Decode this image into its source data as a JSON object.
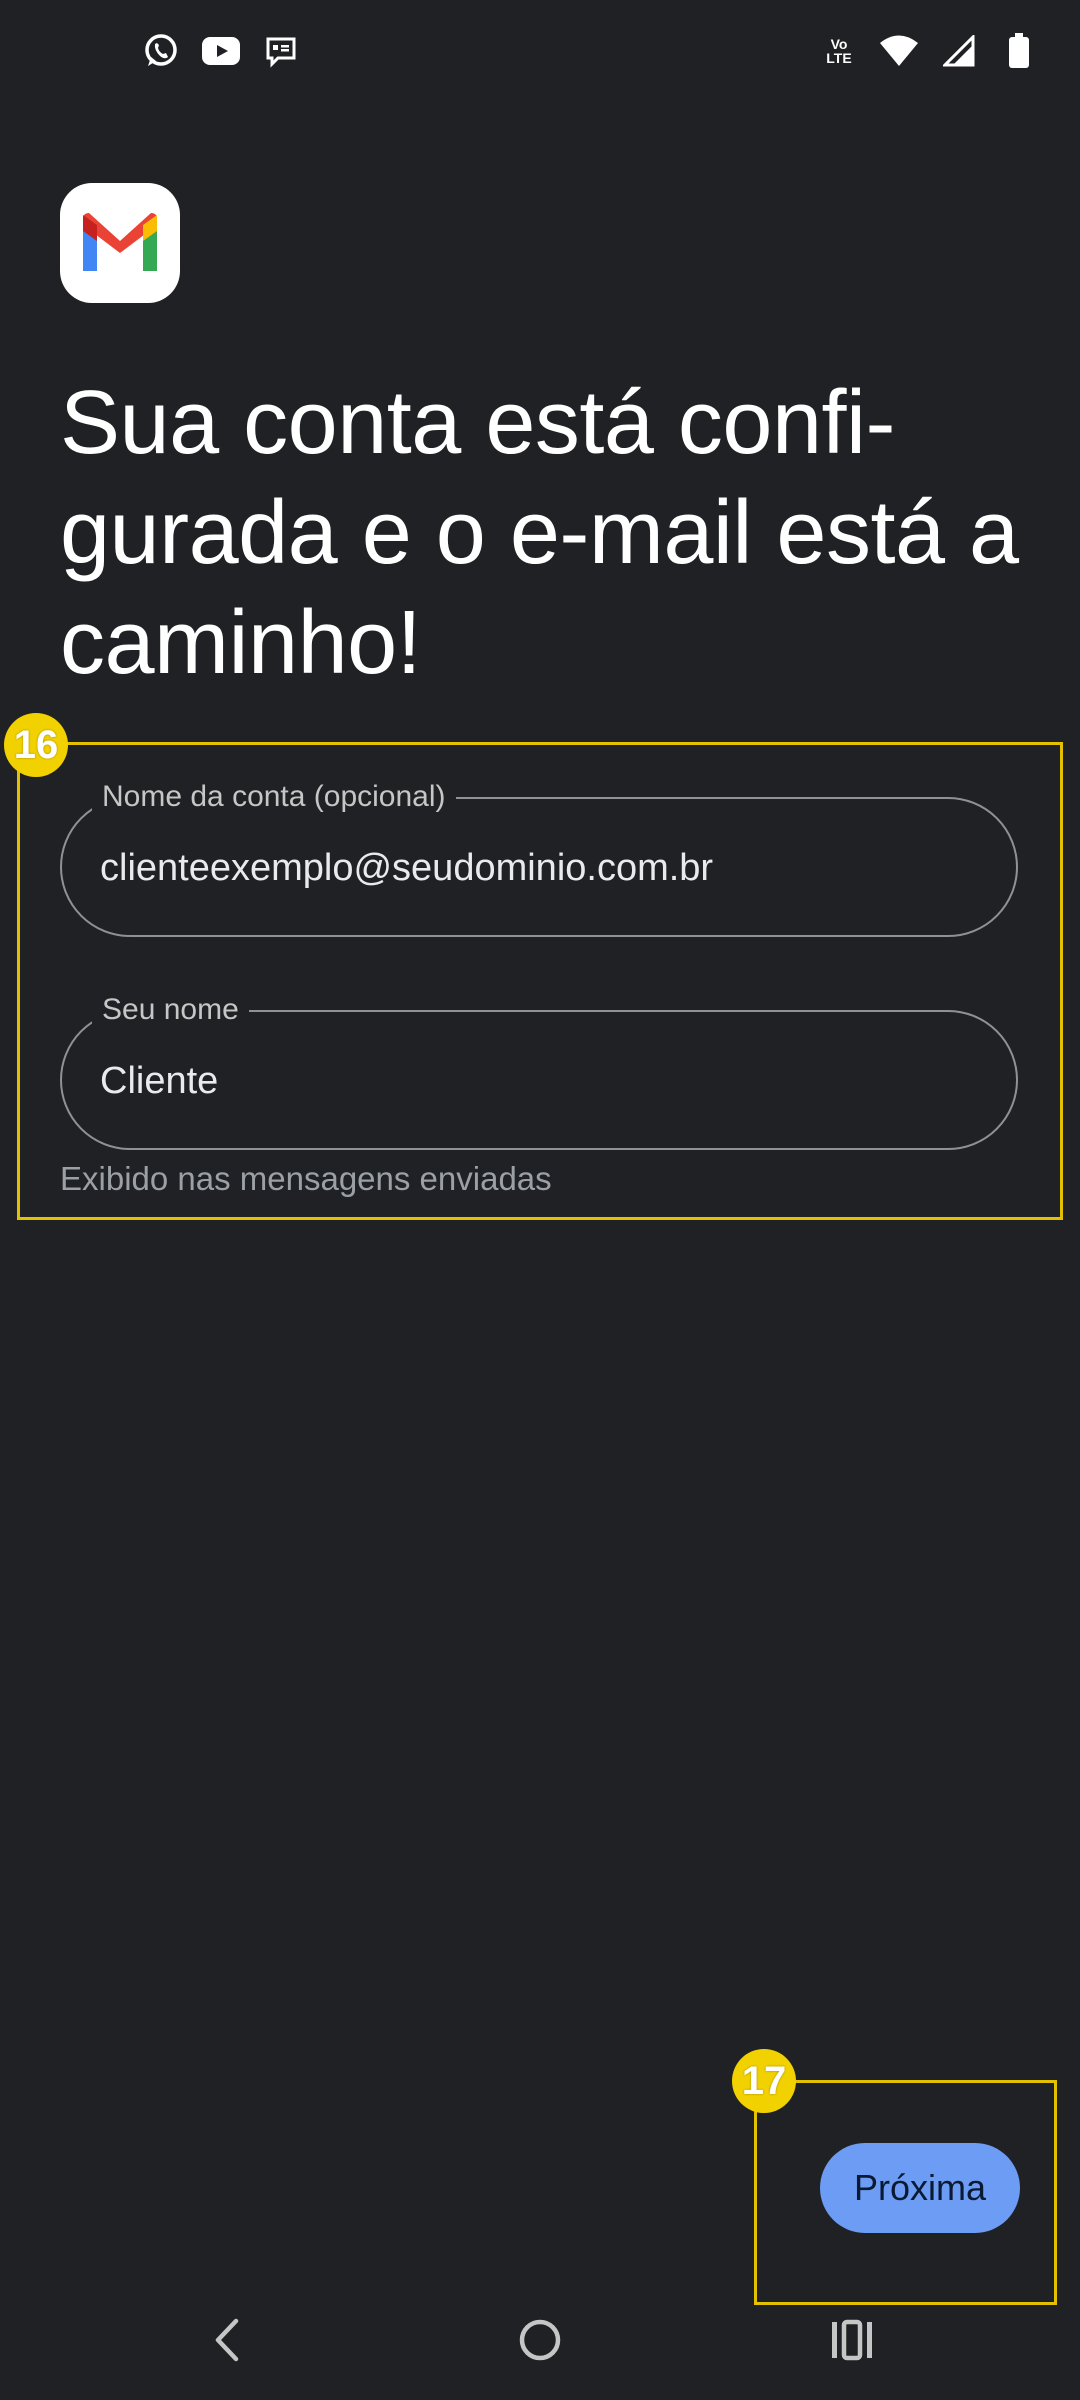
{
  "status_bar": {
    "left_icons": [
      "whatsapp-icon",
      "youtube-icon",
      "message-icon"
    ],
    "right_icons": [
      "volte-icon",
      "wifi-icon",
      "signal-icon",
      "battery-icon"
    ],
    "volte_text_line1": "Vo",
    "volte_text_line2": "LTE"
  },
  "app": {
    "logo": "gmail-logo-icon",
    "headline": "Sua conta está confi-gurada e o e-mail está a caminho!"
  },
  "form": {
    "account_name": {
      "label": "Nome da conta (opcional)",
      "value": "clienteexemplo@seudominio.com.br"
    },
    "your_name": {
      "label": "Seu nome",
      "value": "Cliente",
      "helper": "Exibido nas mensagens enviadas"
    }
  },
  "actions": {
    "next_label": "Próxima"
  },
  "annotations": {
    "form_badge": "16",
    "next_badge": "17",
    "color": "#e3c000"
  },
  "nav_bar": {
    "icons": [
      "back-icon",
      "home-icon",
      "recents-icon"
    ]
  },
  "colors": {
    "background": "#202124",
    "accent": "#6c9cf4",
    "outline": "#8e9196"
  }
}
